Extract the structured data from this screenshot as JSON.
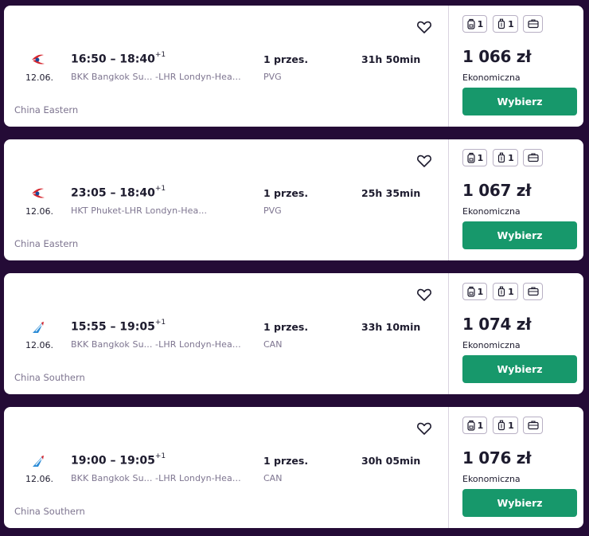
{
  "flights": [
    {
      "airline": "China Eastern",
      "airline_logo": "china-eastern-logo",
      "date": "12.06.",
      "times": "16:50 – 18:40",
      "day_offset": "+1",
      "route": "BKK Bangkok Su... -LHR Londyn-Hea...",
      "stops": "1 przes.",
      "via": "PVG",
      "duration": "31h 50min",
      "price": "1 066 zł",
      "fare_class": "Ekonomiczna",
      "personal_item_count": "1",
      "cabin_bag_count": "1",
      "select_label": "Wybierz"
    },
    {
      "airline": "China Eastern",
      "airline_logo": "china-eastern-logo",
      "date": "12.06.",
      "times": "23:05 – 18:40",
      "day_offset": "+1",
      "route": "HKT Phuket-LHR Londyn-Hea...",
      "stops": "1 przes.",
      "via": "PVG",
      "duration": "25h 35min",
      "price": "1 067 zł",
      "fare_class": "Ekonomiczna",
      "personal_item_count": "1",
      "cabin_bag_count": "1",
      "select_label": "Wybierz"
    },
    {
      "airline": "China Southern",
      "airline_logo": "china-southern-logo",
      "date": "12.06.",
      "times": "15:55 – 19:05",
      "day_offset": "+1",
      "route": "BKK Bangkok Su... -LHR Londyn-Hea...",
      "stops": "1 przes.",
      "via": "CAN",
      "duration": "33h 10min",
      "price": "1 074 zł",
      "fare_class": "Ekonomiczna",
      "personal_item_count": "1",
      "cabin_bag_count": "1",
      "select_label": "Wybierz"
    },
    {
      "airline": "China Southern",
      "airline_logo": "china-southern-logo",
      "date": "12.06.",
      "times": "19:00 – 19:05",
      "day_offset": "+1",
      "route": "BKK Bangkok Su... -LHR Londyn-Hea...",
      "stops": "1 przes.",
      "via": "CAN",
      "duration": "30h 05min",
      "price": "1 076 zł",
      "fare_class": "Ekonomiczna",
      "personal_item_count": "1",
      "cabin_bag_count": "1",
      "select_label": "Wybierz"
    }
  ],
  "icons": {
    "favorite": "heart-outline-icon",
    "personal_item": "backpack-icon",
    "cabin_bag": "cabin-suitcase-icon",
    "checked_bag": "checked-bag-icon"
  },
  "colors": {
    "background": "#240b36",
    "card": "#ffffff",
    "select_button": "#17986b",
    "text_primary": "#1d1b2e",
    "text_secondary": "#7e7590",
    "china_eastern_red": "#d6262e",
    "china_eastern_blue": "#1b4a9a",
    "china_southern_blue": "#2a8bd6"
  }
}
